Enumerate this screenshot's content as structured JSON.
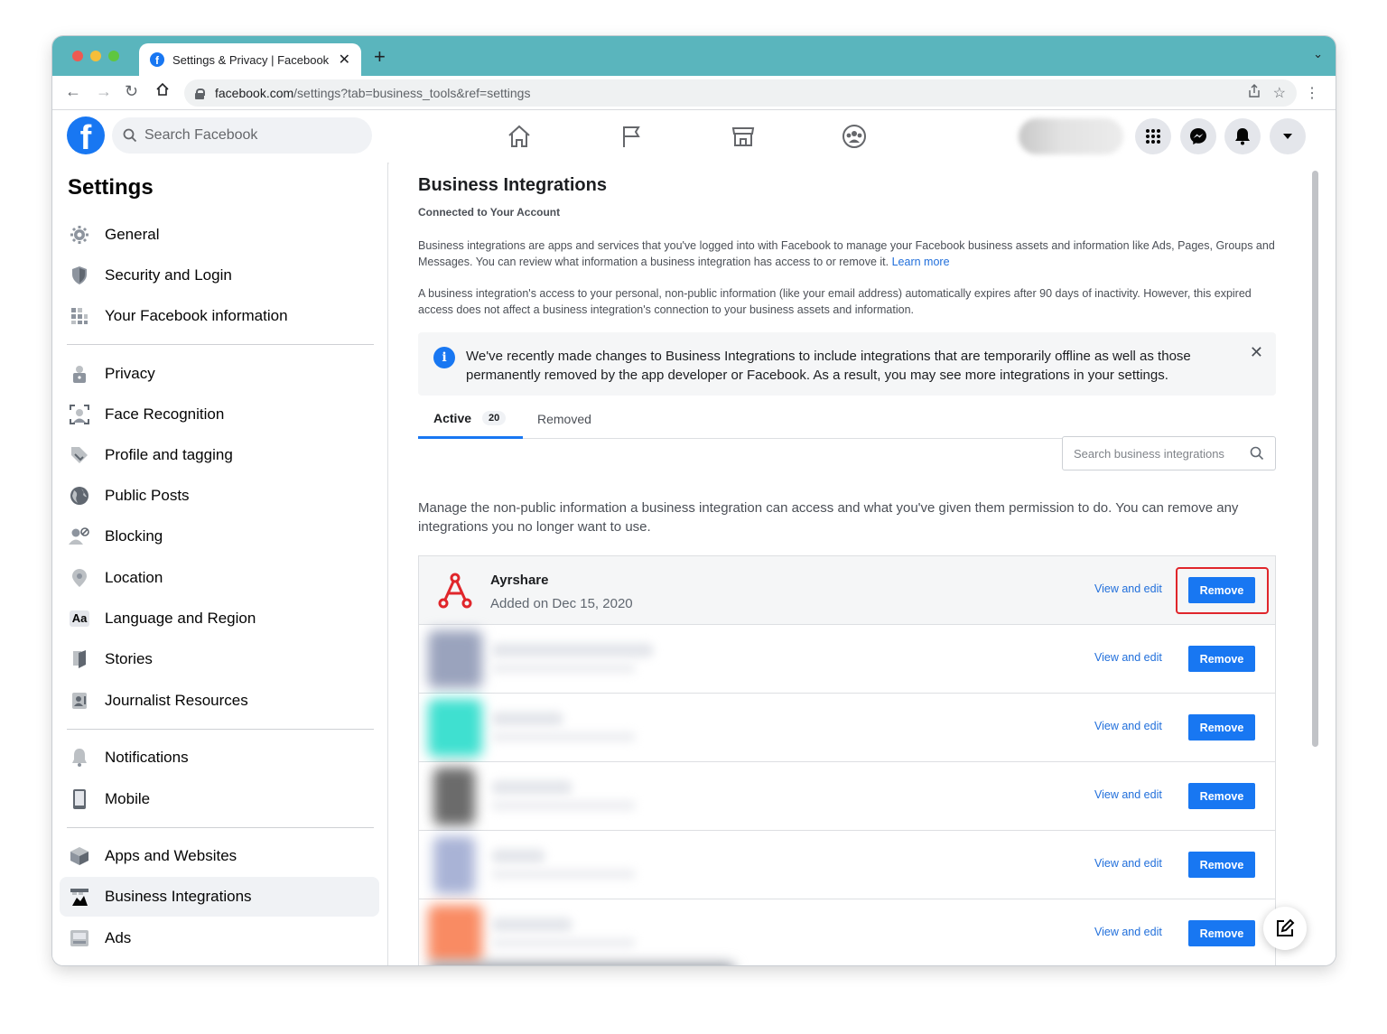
{
  "browser": {
    "tab_title": "Settings & Privacy | Facebook",
    "tab_close": "✕",
    "new_tab": "+",
    "url_host": "facebook.com",
    "url_path": "/settings?tab=business_tools&ref=settings"
  },
  "header": {
    "search_placeholder": "Search Facebook",
    "logo_letter": "f"
  },
  "sidebar": {
    "title": "Settings",
    "groups": [
      [
        {
          "label": "General",
          "icon": "gear-icon"
        },
        {
          "label": "Security and Login",
          "icon": "shield-icon"
        },
        {
          "label": "Your Facebook information",
          "icon": "grid-info-icon"
        }
      ],
      [
        {
          "label": "Privacy",
          "icon": "lock-icon"
        },
        {
          "label": "Face Recognition",
          "icon": "face-scan-icon"
        },
        {
          "label": "Profile and tagging",
          "icon": "tag-icon"
        },
        {
          "label": "Public Posts",
          "icon": "globe-icon"
        },
        {
          "label": "Blocking",
          "icon": "block-user-icon"
        },
        {
          "label": "Location",
          "icon": "location-pin-icon"
        },
        {
          "label": "Language and Region",
          "icon": "language-icon"
        },
        {
          "label": "Stories",
          "icon": "book-icon"
        },
        {
          "label": "Journalist Resources",
          "icon": "id-card-icon"
        }
      ],
      [
        {
          "label": "Notifications",
          "icon": "bell-icon"
        },
        {
          "label": "Mobile",
          "icon": "phone-icon"
        }
      ],
      [
        {
          "label": "Apps and Websites",
          "icon": "cube-icon"
        },
        {
          "label": "Business Integrations",
          "icon": "business-icon",
          "active": true
        },
        {
          "label": "Ads",
          "icon": "ads-icon"
        }
      ]
    ]
  },
  "main": {
    "title": "Business Integrations",
    "subtitle": "Connected to Your Account",
    "para1": "Business integrations are apps and services that you've logged into with Facebook to manage your Facebook business assets and information like Ads, Pages, Groups and Messages. You can review what information a business integration has access to or remove it.",
    "learn_more": "Learn more",
    "para2": "A business integration's access to your personal, non-public information (like your email address) automatically expires after 90 days of inactivity. However, this expired access does not affect a business integration's connection to your business assets and information.",
    "notice": "We've recently made changes to Business Integrations to include integrations that are temporarily offline as well as those permanently removed by the app developer or Facebook. As a result, you may see more integrations in your settings.",
    "notice_icon_glyph": "i",
    "notice_close": "✕",
    "tabs": {
      "active_label": "Active",
      "active_count": "20",
      "removed_label": "Removed"
    },
    "search_placeholder": "Search business integrations",
    "manage_text": "Manage the non-public information a business integration can access and what you've given them permission to do. You can remove any integrations you no longer want to use.",
    "view_edit_label": "View and edit",
    "remove_label": "Remove",
    "integrations": [
      {
        "name": "Ayrshare",
        "date": "Added on Dec 15, 2020",
        "logo_color": "#e0262b"
      },
      {
        "blurred": true,
        "logo_color": "#9aa3bd"
      },
      {
        "blurred": true,
        "logo_color": "#3fe0d0"
      },
      {
        "blurred": true,
        "logo_color": "#6b6b6b"
      },
      {
        "blurred": true,
        "logo_color": "#a9b3d6"
      },
      {
        "blurred": true,
        "logo_color": "#f98b63"
      }
    ]
  },
  "colors": {
    "accent": "#1877f2",
    "highlight": "#e0262b",
    "chrome": "#5ab5bd"
  }
}
